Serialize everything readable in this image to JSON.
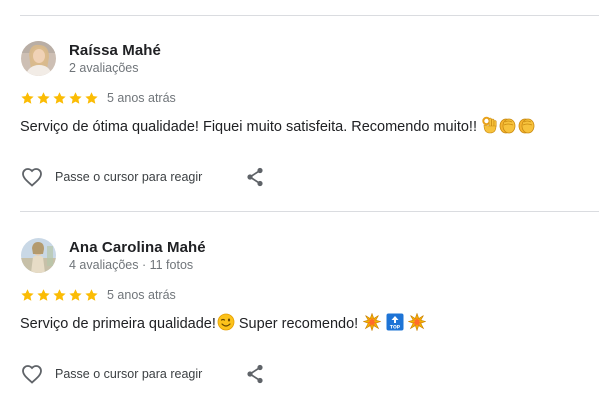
{
  "reviews": [
    {
      "author": "Raíssa Mahé",
      "meta": "2 avaliações",
      "rating": 5,
      "date": "5 anos atrás",
      "text": "Serviço de ótima qualidade! Fiquei muito satisfeita. Recomendo muito!!",
      "emoji_icons": [
        "ok-hand-icon",
        "clapping-hands-icon",
        "clapping-hands-icon"
      ],
      "react_label": "Passe o cursor para reagir"
    },
    {
      "author": "Ana Carolina Mahé",
      "meta": "4 avaliações · 11 fotos",
      "rating": 5,
      "date": "5 anos atrás",
      "text_before": "Serviço de primeira qualidade!",
      "text_after": " Super recomendo!",
      "emoji_icons": [
        "winking-face-icon",
        "collision-icon",
        "top-arrow-icon",
        "collision-icon"
      ],
      "react_label": "Passe o cursor para reagir"
    }
  ],
  "colors": {
    "star": "#fbbc04",
    "divider": "#dadce0",
    "meta_text": "#70757a",
    "icon": "#5f6368"
  }
}
